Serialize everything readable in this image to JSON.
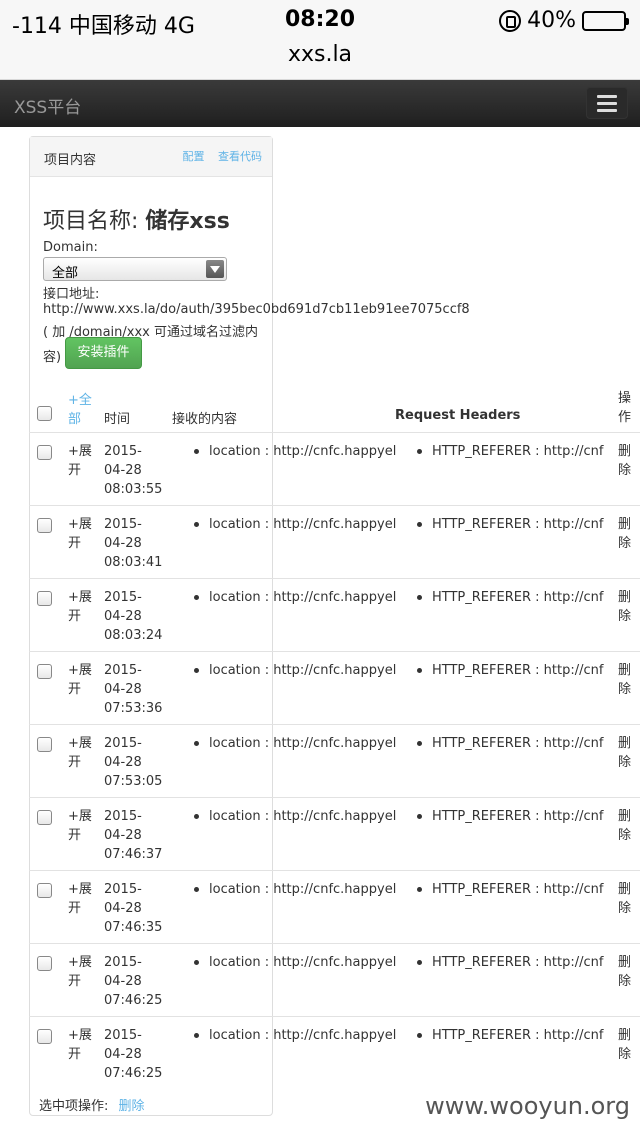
{
  "status_bar": {
    "carrier": "-114 中国移动  4G",
    "time": "08:20",
    "battery": "40%",
    "battery_level": 0.4
  },
  "browser": {
    "url": "xxs.la"
  },
  "navbar": {
    "brand": "XSS平台"
  },
  "panel": {
    "title": "项目内容",
    "link_config": "配置",
    "link_code": "查看代码"
  },
  "project": {
    "name_label": "项目名称: ",
    "name_value": "储存xss",
    "domain_label": "Domain:",
    "domain_selected": "全部",
    "api_label": "接口地址:",
    "api_url": "http://www.xxs.la/do/auth/395bec0bd691d7cb11eb91ee7075ccf8",
    "hint_line1": "( 加 /domain/xxx 可通过域名过滤内",
    "hint_line2": "容)",
    "install_button": "安装插件"
  },
  "table": {
    "col_expand_all_1": "+全",
    "col_expand_all_2": "部",
    "col_time": "时间",
    "col_content": "接收的内容",
    "col_headers": "Request Headers",
    "col_ops_1": "操",
    "col_ops_2": "作",
    "rows": [
      {
        "expand_1": "+展",
        "expand_2": "开",
        "date1": "2015-",
        "date2": "04-28",
        "time": "08:03:55",
        "content": "location : http://cnfc.happyel",
        "header": "HTTP_REFERER : http://cnf",
        "del_1": "删",
        "del_2": "除"
      },
      {
        "expand_1": "+展",
        "expand_2": "开",
        "date1": "2015-",
        "date2": "04-28",
        "time": "08:03:41",
        "content": "location : http://cnfc.happyel",
        "header": "HTTP_REFERER : http://cnf",
        "del_1": "删",
        "del_2": "除"
      },
      {
        "expand_1": "+展",
        "expand_2": "开",
        "date1": "2015-",
        "date2": "04-28",
        "time": "08:03:24",
        "content": "location : http://cnfc.happyel",
        "header": "HTTP_REFERER : http://cnf",
        "del_1": "删",
        "del_2": "除"
      },
      {
        "expand_1": "+展",
        "expand_2": "开",
        "date1": "2015-",
        "date2": "04-28",
        "time": "07:53:36",
        "content": "location : http://cnfc.happyel",
        "header": "HTTP_REFERER : http://cnf",
        "del_1": "删",
        "del_2": "除"
      },
      {
        "expand_1": "+展",
        "expand_2": "开",
        "date1": "2015-",
        "date2": "04-28",
        "time": "07:53:05",
        "content": "location : http://cnfc.happyel",
        "header": "HTTP_REFERER : http://cnf",
        "del_1": "删",
        "del_2": "除"
      },
      {
        "expand_1": "+展",
        "expand_2": "开",
        "date1": "2015-",
        "date2": "04-28",
        "time": "07:46:37",
        "content": "location : http://cnfc.happyel",
        "header": "HTTP_REFERER : http://cnf",
        "del_1": "删",
        "del_2": "除"
      },
      {
        "expand_1": "+展",
        "expand_2": "开",
        "date1": "2015-",
        "date2": "04-28",
        "time": "07:46:35",
        "content": "location : http://cnfc.happyel",
        "header": "HTTP_REFERER : http://cnf",
        "del_1": "删",
        "del_2": "除"
      },
      {
        "expand_1": "+展",
        "expand_2": "开",
        "date1": "2015-",
        "date2": "04-28",
        "time": "07:46:25",
        "content": "location : http://cnfc.happyel",
        "header": "HTTP_REFERER : http://cnf",
        "del_1": "删",
        "del_2": "除"
      },
      {
        "expand_1": "+展",
        "expand_2": "开",
        "date1": "2015-",
        "date2": "04-28",
        "time": "07:46:25",
        "content": "location : http://cnfc.happyel",
        "header": "HTTP_REFERER : http://cnf",
        "del_1": "删",
        "del_2": "除"
      }
    ]
  },
  "footer": {
    "selected_ops_label": "选中项操作:",
    "delete_link": "删除"
  },
  "watermark": "www.wooyun.org",
  "colors": {
    "link": "#5fb3e6",
    "install_button": "#51a351",
    "navbar": "#222222"
  }
}
